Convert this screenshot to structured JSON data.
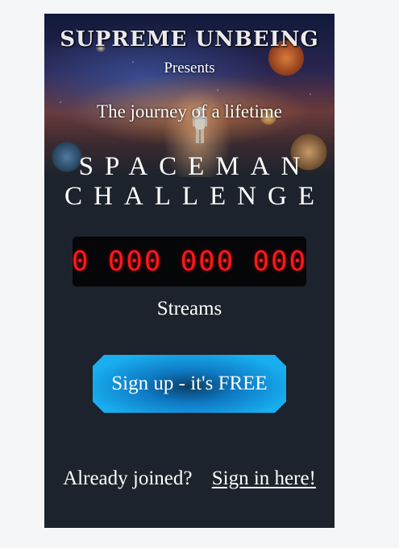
{
  "hero": {
    "brand": "SUPREME UNBEING",
    "presents": "Presents",
    "tagline": "The journey of a lifetime",
    "title_line1": "SPACEMAN",
    "title_line2": "CHALLENGE",
    "image_icon": "space-astronaut-illustration"
  },
  "counter": {
    "value": "0 000 000 000",
    "label": "Streams",
    "digit_color": "#ff1a1a"
  },
  "signup": {
    "label": "Sign up - it's FREE",
    "accent": "#19aef0"
  },
  "signin": {
    "prompt": "Already joined?",
    "link": "Sign in here!"
  },
  "colors": {
    "page_background": "#f5f6f7",
    "panel_background": "#1c232c",
    "counter_background": "#050608"
  }
}
